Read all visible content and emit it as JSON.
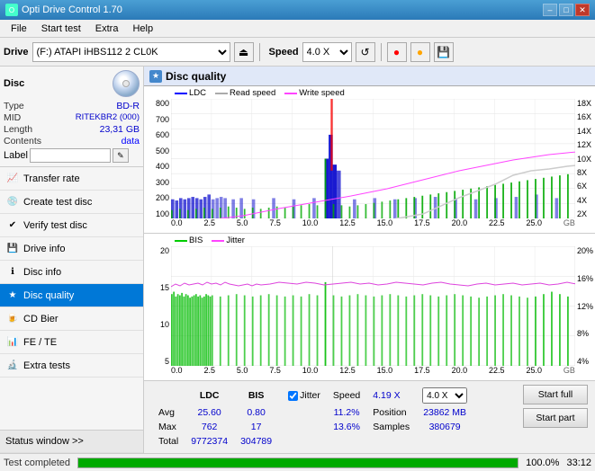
{
  "titleBar": {
    "title": "Opti Drive Control 1.70",
    "minimizeBtn": "–",
    "maximizeBtn": "□",
    "closeBtn": "✕"
  },
  "menuBar": {
    "items": [
      "File",
      "Start test",
      "Extra",
      "Help"
    ]
  },
  "toolbar": {
    "driveLabel": "Drive",
    "driveValue": "(F:)  ATAPI iHBS112  2 CL0K",
    "speedLabel": "Speed",
    "speedValue": "4.0 X"
  },
  "disc": {
    "header": "Disc",
    "typeLabel": "Type",
    "typeValue": "BD-R",
    "midLabel": "MID",
    "midValue": "RITEKBR2 (000)",
    "lengthLabel": "Length",
    "lengthValue": "23,31 GB",
    "contentsLabel": "Contents",
    "contentsValue": "data",
    "labelLabel": "Label"
  },
  "navItems": [
    {
      "id": "transfer-rate",
      "label": "Transfer rate",
      "icon": "📈"
    },
    {
      "id": "create-test-disc",
      "label": "Create test disc",
      "icon": "💿"
    },
    {
      "id": "verify-test-disc",
      "label": "Verify test disc",
      "icon": "✔"
    },
    {
      "id": "drive-info",
      "label": "Drive info",
      "icon": "💾"
    },
    {
      "id": "disc-info",
      "label": "Disc info",
      "icon": "ℹ"
    },
    {
      "id": "disc-quality",
      "label": "Disc quality",
      "icon": "★",
      "active": true
    },
    {
      "id": "cd-bier",
      "label": "CD Bier",
      "icon": "🍺"
    },
    {
      "id": "fe-te",
      "label": "FE / TE",
      "icon": "📊"
    },
    {
      "id": "extra-tests",
      "label": "Extra tests",
      "icon": "🔬"
    }
  ],
  "statusWindow": {
    "label": "Status window >>",
    "statusText": "Test completed",
    "progressPercent": 100,
    "time": "33:12"
  },
  "discQuality": {
    "title": "Disc quality",
    "chart1": {
      "legend": [
        {
          "label": "LDC",
          "color": "#0000ff"
        },
        {
          "label": "Read speed",
          "color": "#ffffff"
        },
        {
          "label": "Write speed",
          "color": "#ff44ff"
        }
      ],
      "yAxisLeft": [
        "800",
        "700",
        "600",
        "500",
        "400",
        "300",
        "200",
        "100"
      ],
      "yAxisRight": [
        "18X",
        "16X",
        "14X",
        "12X",
        "10X",
        "8X",
        "6X",
        "4X",
        "2X"
      ],
      "xAxis": [
        "0.0",
        "2.5",
        "5.0",
        "7.5",
        "10.0",
        "12.5",
        "15.0",
        "17.5",
        "20.0",
        "22.5",
        "25.0"
      ],
      "xLabel": "GB"
    },
    "chart2": {
      "legend": [
        {
          "label": "BIS",
          "color": "#00cc00"
        },
        {
          "label": "Jitter",
          "color": "#ff44ff"
        }
      ],
      "yAxisLeft": [
        "20",
        "15",
        "10",
        "5"
      ],
      "yAxisRight": [
        "20%",
        "16%",
        "12%",
        "8%",
        "4%"
      ],
      "xAxis": [
        "0.0",
        "2.5",
        "5.0",
        "7.5",
        "10.0",
        "12.5",
        "15.0",
        "17.5",
        "20.0",
        "22.5",
        "25.0"
      ],
      "xLabel": "GB"
    }
  },
  "stats": {
    "columns": [
      "",
      "LDC",
      "BIS",
      "",
      "Jitter",
      "Speed",
      ""
    ],
    "rows": [
      {
        "label": "Avg",
        "ldc": "25.60",
        "bis": "0.80",
        "jitter": "11.2%",
        "speedLabel": "Speed",
        "speedVal": "4.19 X",
        "speedSelect": "4.0 X"
      },
      {
        "label": "Max",
        "ldc": "762",
        "bis": "17",
        "jitter": "13.6%",
        "posLabel": "Position",
        "posVal": "23862 MB"
      },
      {
        "label": "Total",
        "ldc": "9772374",
        "bis": "304789",
        "samplesLabel": "Samples",
        "samplesVal": "380679"
      }
    ],
    "jitterChecked": true,
    "startFullBtn": "Start full",
    "startPartBtn": "Start part"
  }
}
